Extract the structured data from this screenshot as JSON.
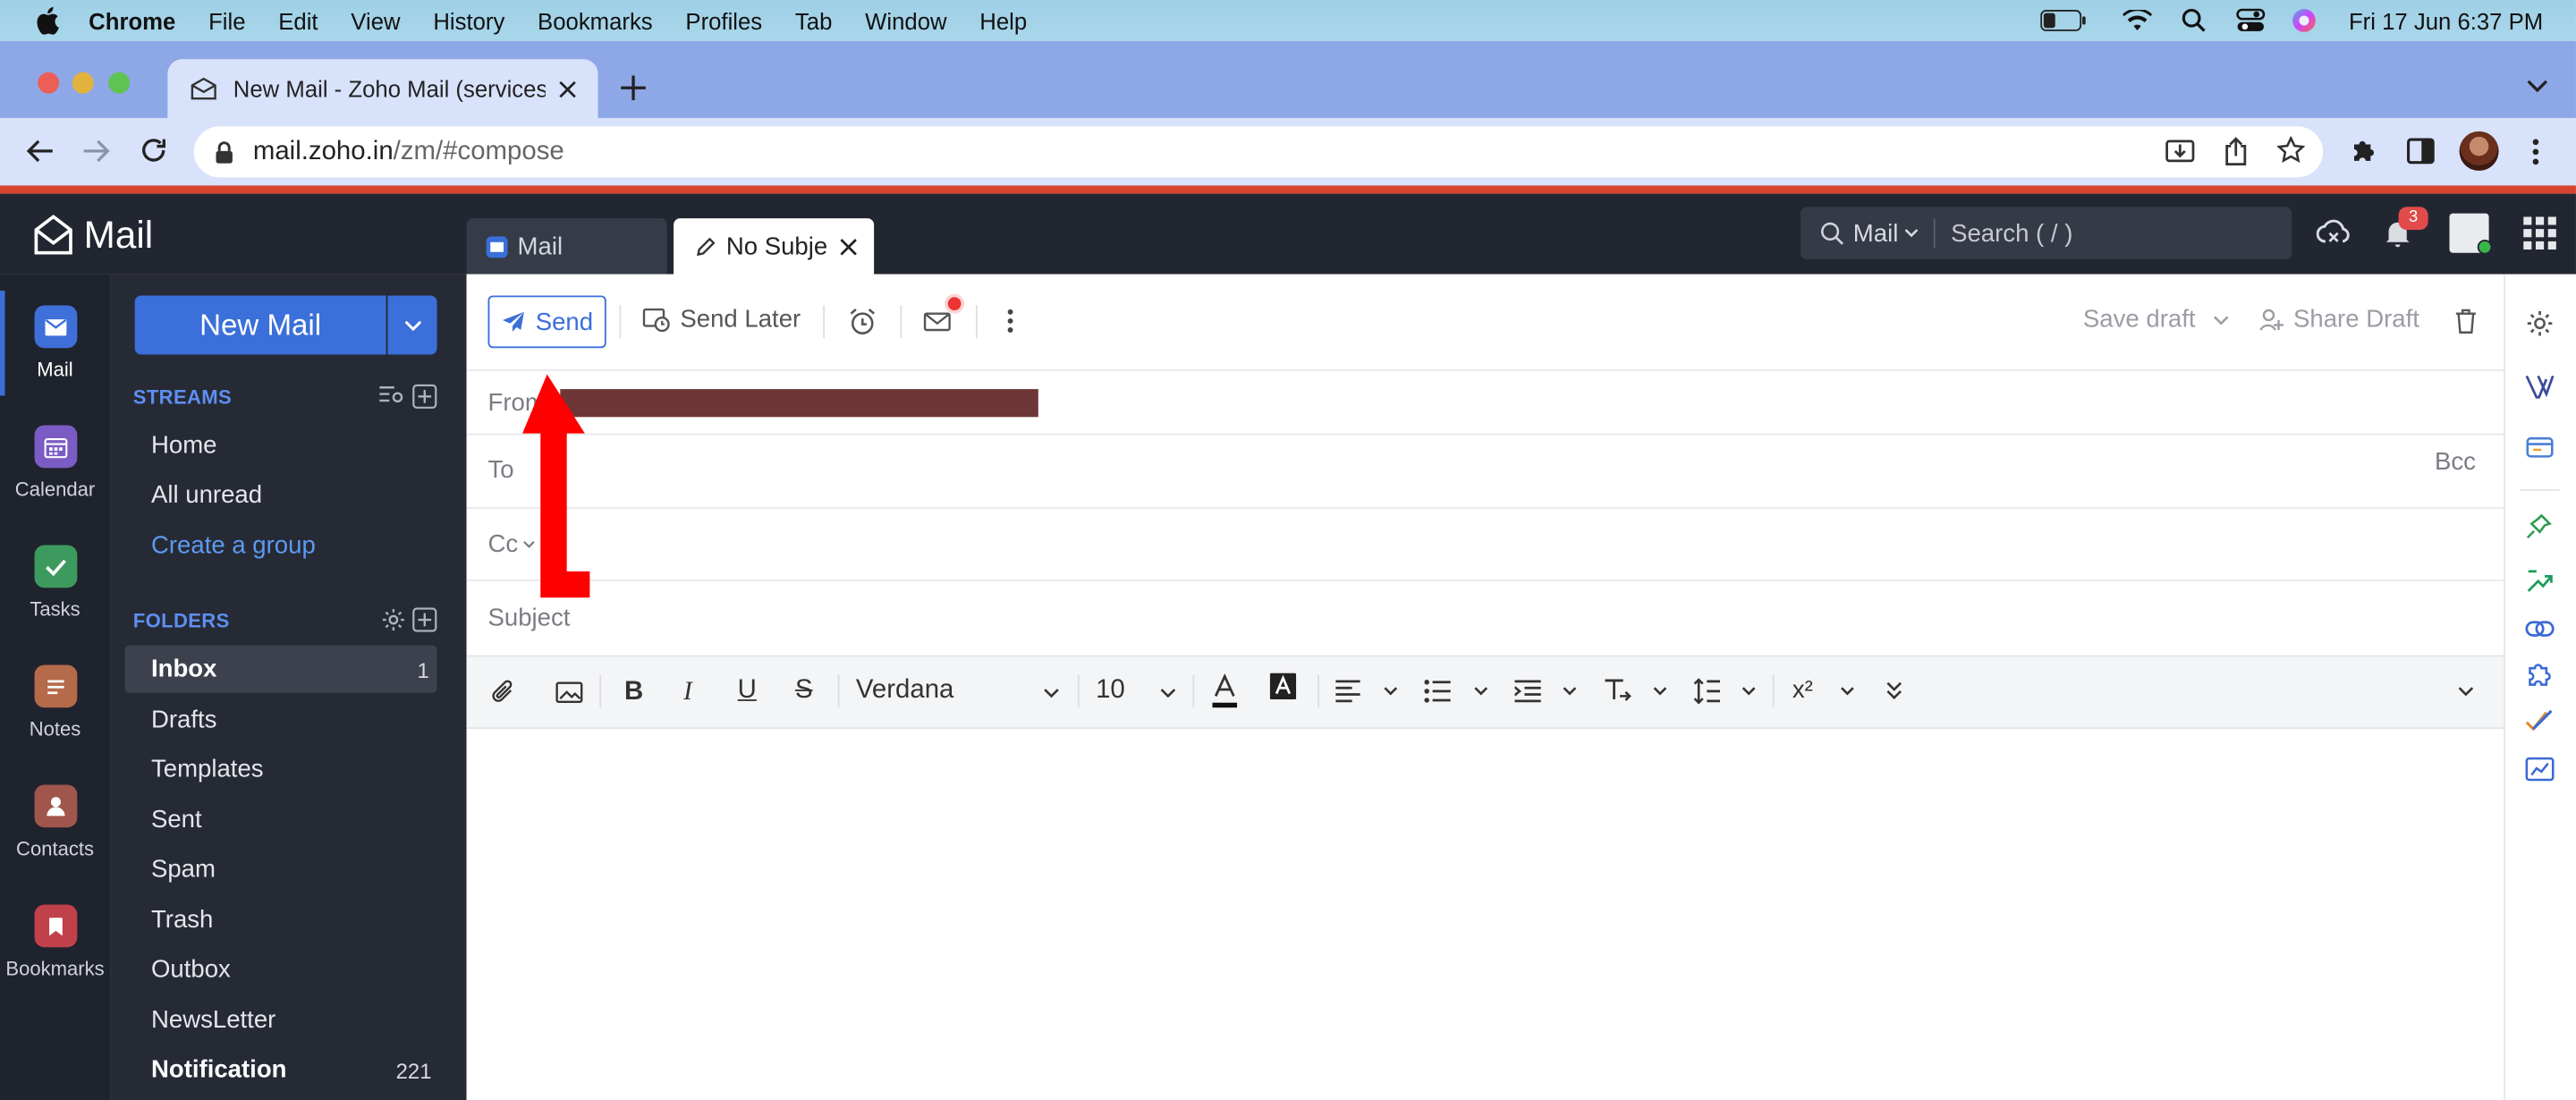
{
  "menubar": {
    "app": "Chrome",
    "items": [
      "File",
      "Edit",
      "View",
      "History",
      "Bookmarks",
      "Profiles",
      "Tab",
      "Window",
      "Help"
    ],
    "datetime": "Fri 17 Jun  6:37 PM"
  },
  "browser": {
    "tab_title": "New Mail - Zoho Mail (services",
    "url_host": "mail.zoho.in",
    "url_path": "/zm/#compose"
  },
  "app": {
    "logo": "Mail",
    "search_scope": "Mail",
    "search_placeholder": "Search ( / )",
    "notification_count": "3",
    "tabs": [
      {
        "label": "Mail"
      },
      {
        "label": "No Subjec"
      }
    ]
  },
  "leftnav": [
    {
      "label": "Mail",
      "color": "#3f6fd8"
    },
    {
      "label": "Calendar",
      "color": "#7b5cc4"
    },
    {
      "label": "Tasks",
      "color": "#3c9a5f"
    },
    {
      "label": "Notes",
      "color": "#b56a4a"
    },
    {
      "label": "Contacts",
      "color": "#a0564d"
    },
    {
      "label": "Bookmarks",
      "color": "#c0404b"
    }
  ],
  "sidebar": {
    "new_mail": "New Mail",
    "streams_title": "STREAMS",
    "streams": [
      "Home",
      "All unread"
    ],
    "create_group": "Create a group",
    "folders_title": "FOLDERS",
    "folders": [
      {
        "name": "Inbox",
        "count": "1"
      },
      {
        "name": "Drafts",
        "count": ""
      },
      {
        "name": "Templates",
        "count": ""
      },
      {
        "name": "Sent",
        "count": ""
      },
      {
        "name": "Spam",
        "count": ""
      },
      {
        "name": "Trash",
        "count": ""
      },
      {
        "name": "Outbox",
        "count": ""
      },
      {
        "name": "NewsLetter",
        "count": ""
      },
      {
        "name": "Notification",
        "count": "221"
      }
    ]
  },
  "compose": {
    "send": "Send",
    "send_later": "Send Later",
    "save_draft": "Save draft",
    "share_draft": "Share Draft",
    "from_label": "From",
    "to_label": "To",
    "bcc_label": "Bcc",
    "cc_label": "Cc",
    "subject_label": "Subject",
    "font": "Verdana",
    "font_size": "10"
  },
  "colors": {
    "accent": "#3b6fd9",
    "annotation_arrow": "#ff0000",
    "redaction": "#6e3636"
  }
}
